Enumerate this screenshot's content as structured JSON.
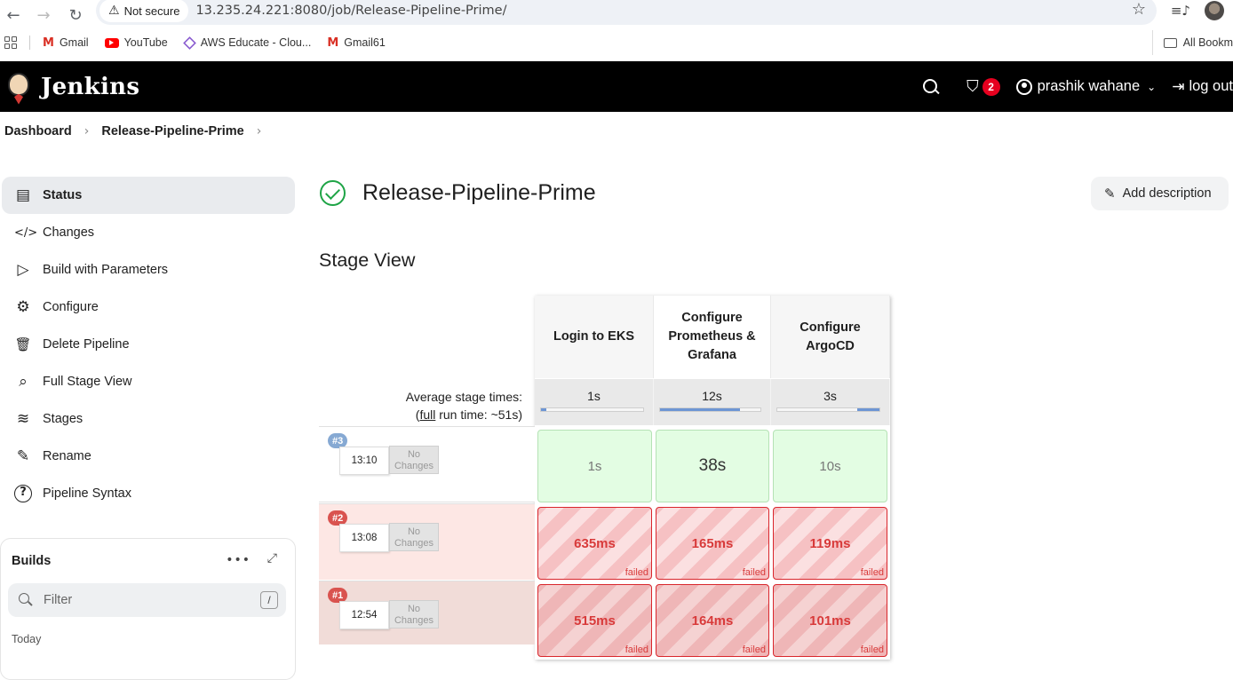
{
  "browser": {
    "security_label": "Not secure",
    "url": "13.235.24.221:8080/job/Release-Pipeline-Prime/",
    "bookmarks": [
      {
        "label": "Gmail",
        "icon": "gmail-icon"
      },
      {
        "label": "YouTube",
        "icon": "youtube-icon"
      },
      {
        "label": "AWS Educate - Clou...",
        "icon": "aws-icon"
      },
      {
        "label": "Gmail61",
        "icon": "gmail-icon"
      }
    ],
    "all_bookmarks_label": "All Bookm"
  },
  "header": {
    "app_name": "Jenkins",
    "security_badge_count": "2",
    "user_name": "prashik wahane",
    "logout_label": "log out"
  },
  "breadcrumb": {
    "items": [
      "Dashboard",
      "Release-Pipeline-Prime"
    ]
  },
  "sidebar": {
    "items": [
      {
        "label": "Status",
        "icon": "notepad-icon",
        "glyph": "▤"
      },
      {
        "label": "Changes",
        "icon": "code-icon",
        "glyph": "</>"
      },
      {
        "label": "Build with Parameters",
        "icon": "play-icon",
        "glyph": "▷"
      },
      {
        "label": "Configure",
        "icon": "gear-icon",
        "glyph": "⚙"
      },
      {
        "label": "Delete Pipeline",
        "icon": "trash-icon",
        "glyph": "🗑"
      },
      {
        "label": "Full Stage View",
        "icon": "search-icon",
        "glyph": "⌕"
      },
      {
        "label": "Stages",
        "icon": "layers-icon",
        "glyph": "≋"
      },
      {
        "label": "Rename",
        "icon": "pencil-icon",
        "glyph": "✎"
      },
      {
        "label": "Pipeline Syntax",
        "icon": "help-icon",
        "glyph": "?"
      }
    ]
  },
  "builds": {
    "title": "Builds",
    "filter_placeholder": "Filter",
    "filter_shortcut": "/",
    "group_label": "Today"
  },
  "main": {
    "job_title": "Release-Pipeline-Prime",
    "add_description_label": "Add description",
    "stage_view_title": "Stage View"
  },
  "stage_view": {
    "stages": [
      "Login to EKS",
      "Configure Prometheus & Grafana",
      "Configure ArgoCD"
    ],
    "avg_label_line1": "Average stage times:",
    "avg_label_full": "full",
    "avg_label_rest": " run time: ~51s)",
    "avg_times": [
      "1s",
      "12s",
      "3s"
    ],
    "avg_bars": [
      {
        "offset": 0.0,
        "fraction": 0.05
      },
      {
        "offset": 0.0,
        "fraction": 0.8
      },
      {
        "offset": 0.78,
        "fraction": 0.22
      }
    ],
    "builds": [
      {
        "number": "#3",
        "time": "13:10",
        "changes": "No Changes",
        "status": "success",
        "stages": [
          {
            "duration": "1s"
          },
          {
            "duration": "38s"
          },
          {
            "duration": "10s"
          }
        ]
      },
      {
        "number": "#2",
        "time": "13:08",
        "changes": "No Changes",
        "status": "failed",
        "stages": [
          {
            "duration": "635ms",
            "state": "failed"
          },
          {
            "duration": "165ms",
            "state": "failed"
          },
          {
            "duration": "119ms",
            "state": "failed"
          }
        ]
      },
      {
        "number": "#1",
        "time": "12:54",
        "changes": "No Changes",
        "status": "failed",
        "stages": [
          {
            "duration": "515ms",
            "state": "failed"
          },
          {
            "duration": "164ms",
            "state": "failed"
          },
          {
            "duration": "101ms",
            "state": "failed"
          }
        ]
      }
    ]
  },
  "colors": {
    "success": "#1ea446",
    "failed": "#d83a3a",
    "badge_success": "#86a9d3",
    "badge_failed": "#d9534f",
    "header_bg": "#000000"
  }
}
